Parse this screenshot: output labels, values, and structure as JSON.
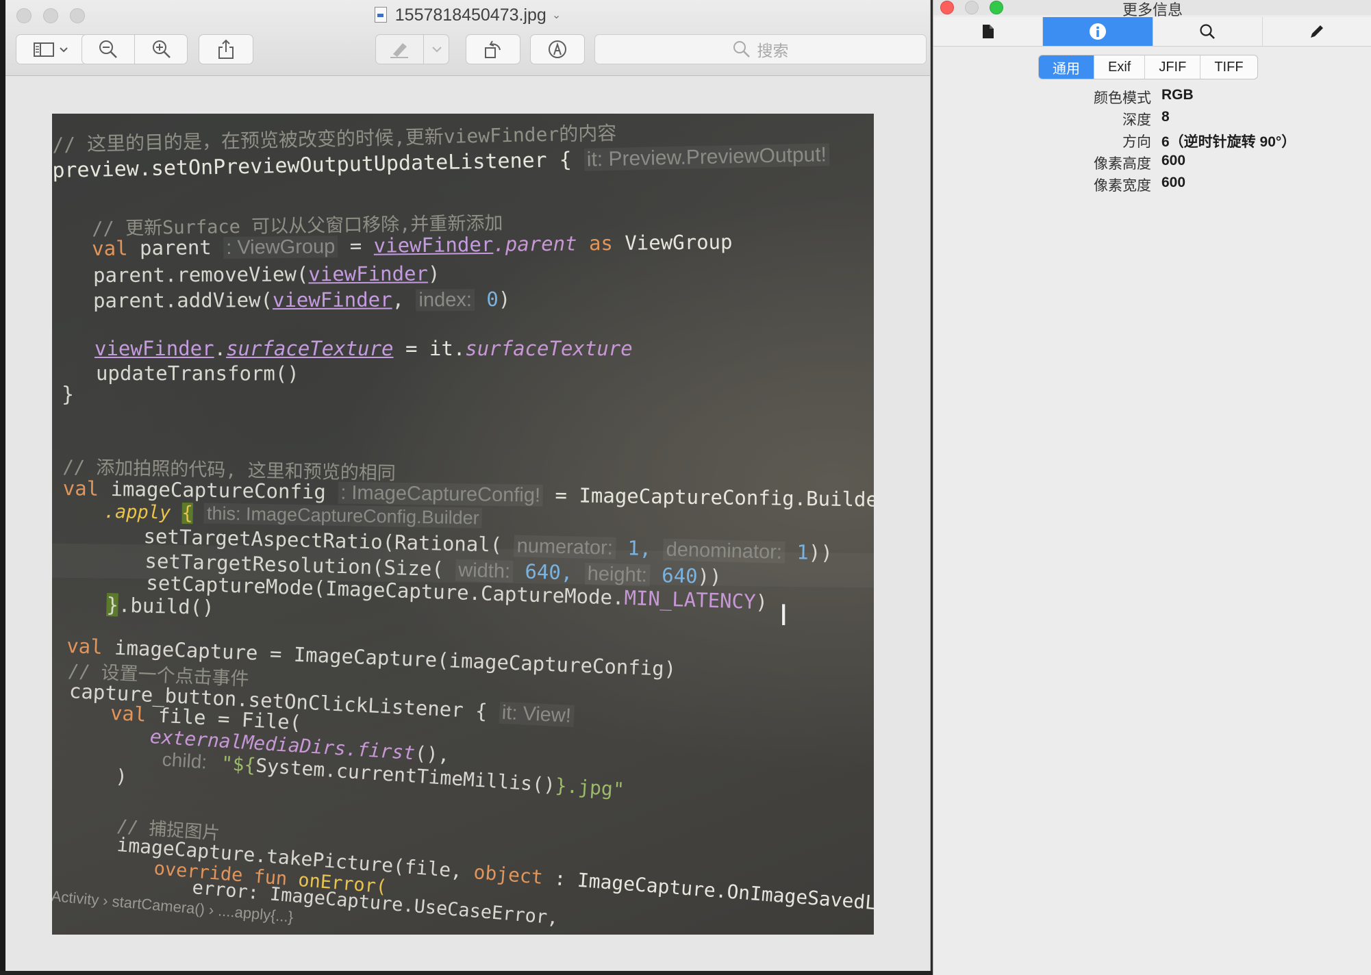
{
  "preview": {
    "file_name": "1557818450473.jpg",
    "search_placeholder": "搜索"
  },
  "toolbar": {
    "sidebar_icon": "sidebar-icon",
    "zoom_out_icon": "zoom-out-icon",
    "zoom_in_icon": "zoom-in-icon",
    "share_icon": "share-icon",
    "highlight_icon": "highlighter-icon",
    "rotate_icon": "rotate-icon",
    "markup_icon": "markup-icon"
  },
  "photo_code": {
    "l1": "// 这里的目的是，在预览被改变的时候,更新viewFinder的内容",
    "l2a": "preview.setOnPreviewOutputUpdateListener {",
    "l2b": "it: Preview.PreviewOutput!",
    "l3": "// 更新Surface 可以从父窗口移除,并重新添加",
    "l4a": "val",
    "l4b": "parent",
    "l4c": ": ViewGroup",
    "l4d": "=",
    "l4e": "viewFinder",
    "l4f": ".parent",
    "l4g": "as",
    "l4h": "ViewGroup",
    "l5a": "parent.removeView(",
    "l5b": "viewFinder",
    "l5c": ")",
    "l6a": "parent.addView(",
    "l6b": "viewFinder",
    "l6c": ",",
    "l6d": "index:",
    "l6e": "0",
    "l6f": ")",
    "l7a": "viewFinder",
    "l7b": ".",
    "l7c": "surfaceTexture",
    "l7d": "= it.",
    "l7e": "surfaceTexture",
    "l8": "updateTransform()",
    "l9": "}",
    "l10": "// 添加拍照的代码, 这里和预览的相同",
    "l11a": "val",
    "l11b": "imageCaptureConfig",
    "l11c": ": ImageCaptureConfig!",
    "l11d": "= ImageCaptureConfig.Builder()",
    "l12a": ".apply",
    "l12b": "{",
    "l12c": "this: ImageCaptureConfig.Builder",
    "l13a": "setTargetAspectRatio(Rational(",
    "l13b": "numerator:",
    "l13c": "1,",
    "l13d": "denominator:",
    "l13e": "1",
    "l13f": "))",
    "l14a": "setTargetResolution(Size(",
    "l14b": "width:",
    "l14c": "640,",
    "l14d": "height:",
    "l14e": "640",
    "l14f": "))",
    "l15a": "setCaptureMode(ImageCapture.CaptureMode.",
    "l15b": "MIN_LATENCY",
    "l15c": ")",
    "l16a": "}",
    "l16b": ".build()",
    "l17a": "val",
    "l17b": "imageCapture = ImageCapture(imageCaptureConfig)",
    "l18": "// 设置一个点击事件",
    "l19a": "capture_button.setOnClickListener {",
    "l19b": "it: View!",
    "l20a": "val",
    "l20b": "file = File(",
    "l21a": "externalMediaDirs",
    "l21b": ".first",
    "l21c": "(),",
    "l22a": "child:",
    "l22b": "\"${",
    "l22c": "System.currentTimeMillis()",
    "l22d": "}.jpg\"",
    "l23": ")",
    "l24": "// 捕捉图片",
    "l25a": "imageCapture.takePicture(file,",
    "l25b": "object",
    "l25c": ": ImageCapture.OnImageSavedListen",
    "l26a": "override fun",
    "l26b": "onError(",
    "l27": "error: ImageCapture.UseCaseError,",
    "l28a": "Activity",
    "l28b": "startCamera()",
    "l28c": "....apply{...}"
  },
  "inspector": {
    "title": "更多信息",
    "tabs": [
      "file-icon",
      "info-icon",
      "search-icon",
      "pencil-icon"
    ],
    "segments": [
      "通用",
      "Exif",
      "JFIF",
      "TIFF"
    ],
    "active_segment": "通用",
    "properties": [
      {
        "label": "颜色模式",
        "value": "RGB"
      },
      {
        "label": "深度",
        "value": "8"
      },
      {
        "label": "方向",
        "value": "6（逆时针旋转 90°）"
      },
      {
        "label": "像素高度",
        "value": "600"
      },
      {
        "label": "像素宽度",
        "value": "600"
      }
    ]
  },
  "colors": {
    "accent": "#3d8ef2",
    "close": "#fc605c",
    "minimize": "#fdbc40",
    "zoom": "#34c84a"
  }
}
